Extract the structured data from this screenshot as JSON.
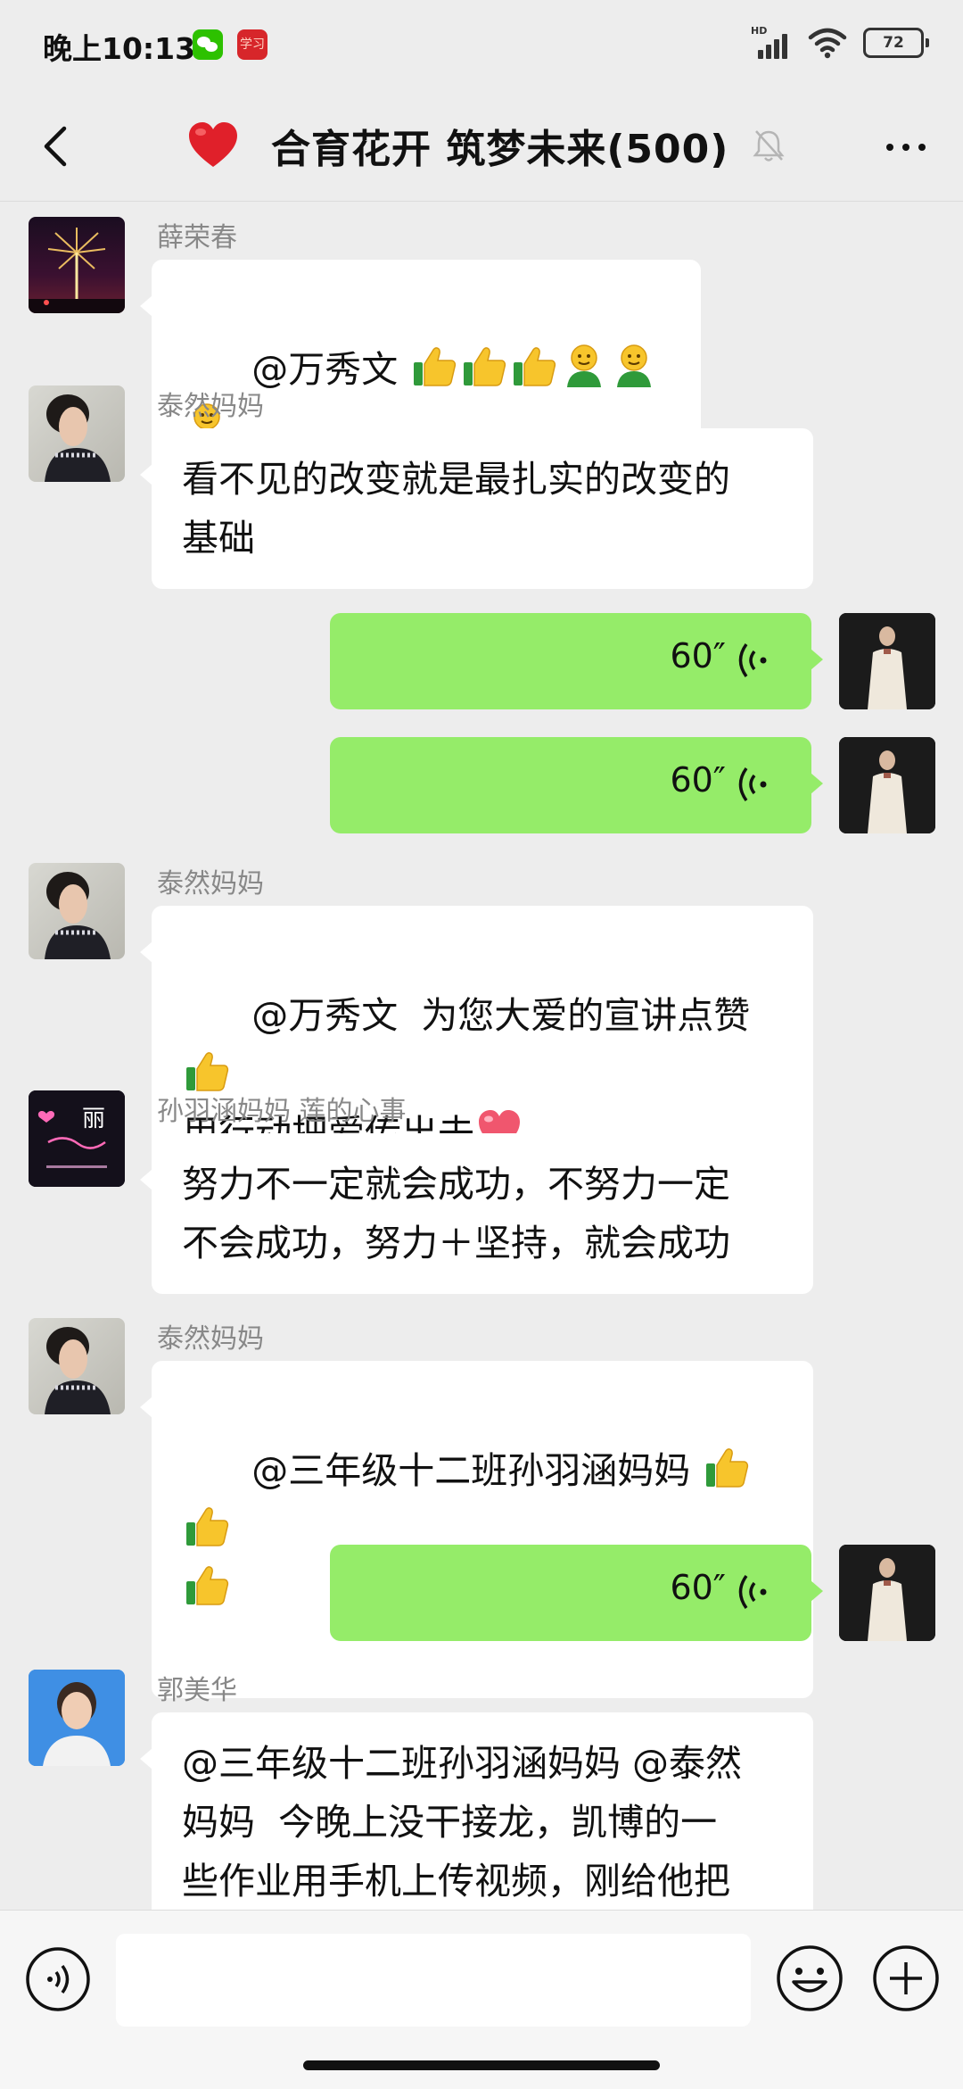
{
  "status_bar": {
    "time": "晚上10:13",
    "signal_label": "HD",
    "battery": "72",
    "study_app_label": "学习"
  },
  "header": {
    "title": "合育花开 筑梦未来(500)"
  },
  "messages": [
    {
      "sender": "薛荣春",
      "text": "@万秀文 "
    },
    {
      "sender": "泰然妈妈",
      "text": "看不见的改变就是最扎实的改变的\n基础"
    },
    {
      "voice_duration": "60″"
    },
    {
      "voice_duration": "60″"
    },
    {
      "sender": "泰然妈妈",
      "text1": "@万秀文  为您大爱的宣讲点赞",
      "text2": "用行动把爱传出去"
    },
    {
      "sender": "孙羽涵妈妈  莲的心事",
      "text": "努力不一定就会成功，不努力一定\n不会成功，努力＋坚持，就会成功",
      "avatar_text": "丽"
    },
    {
      "sender": "泰然妈妈",
      "text": "@三年级十二班孙羽涵妈妈 "
    },
    {
      "voice_duration": "60″"
    },
    {
      "sender": "郭美华",
      "text": "@三年级十二班孙羽涵妈妈 @泰然\n妈妈  今晚上没干接龙，凯博的一\n些作业用手机上传视频，刚给他把"
    }
  ],
  "colors": {
    "voice_bubble": "#95ec69",
    "background": "#ededed"
  }
}
